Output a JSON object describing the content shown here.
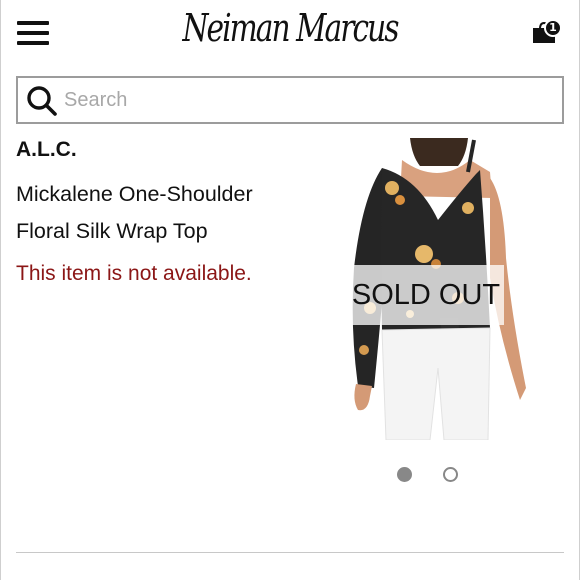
{
  "header": {
    "logo_text": "Neiman Marcus",
    "menu_icon": "hamburger-menu-icon",
    "bag_icon": "shopping-bag-icon",
    "bag_count": "1"
  },
  "search": {
    "placeholder": "Search",
    "value": "",
    "icon": "search-icon"
  },
  "product": {
    "brand": "A.L.C.",
    "name": "Mickalene One-Shoulder Floral Silk Wrap Top",
    "availability": "This item is not available.",
    "availability_color": "#8b1616",
    "sold_out_label": "SOLD OUT"
  },
  "carousel": {
    "total": 2,
    "active": 1
  }
}
